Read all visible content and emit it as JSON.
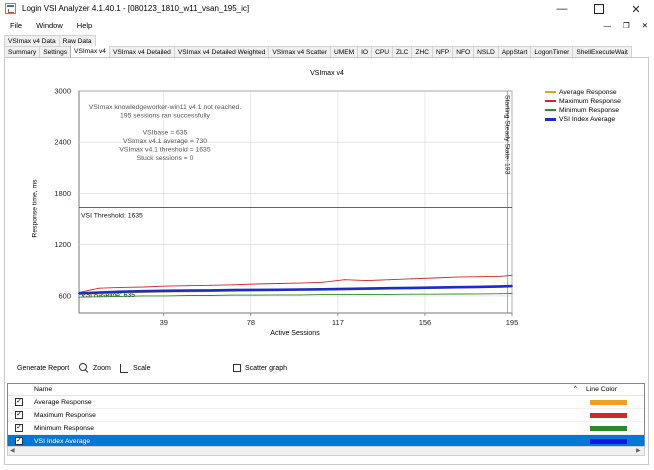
{
  "window": {
    "title": "Login VSI Analyzer 4.1.40.1 - [080123_1810_w11_vsan_195_ic]"
  },
  "menu": [
    "File",
    "Window",
    "Help"
  ],
  "tabs_row1": [
    "VSImax v4 Data",
    "Raw Data"
  ],
  "tabs_row2": [
    "Summary",
    "Settings",
    "VSImax v4",
    "VSImax v4 Detailed",
    "VSImax v4 Detailed Weighted",
    "VSImax v4 Scatter",
    "UMEM",
    "IO",
    "CPU",
    "ZLC",
    "ZHC",
    "NFP",
    "NFO",
    "NSLD",
    "AppStart",
    "LogonTimer",
    "ShellExecuteWait"
  ],
  "active_tab": "VSImax v4",
  "chart_data": {
    "type": "line",
    "title": "VSImax v4",
    "xlabel": "Active Sessions",
    "ylabel": "Response time, ms",
    "x_ticks": [
      "39",
      "78",
      "117",
      "156",
      "195"
    ],
    "y_ticks": [
      "600",
      "1200",
      "1800",
      "2400",
      "3000"
    ],
    "xlim": [
      1,
      195
    ],
    "ylim": [
      400,
      3000
    ],
    "info_lines": [
      "VSImax knowledgeworker-win11 v4.1 not reached.",
      "195 sessions ran successfully",
      "",
      "VSIbase = 635",
      "VSImax v4.1 average = 730",
      "VSImax v4.1 threshold = 1635",
      "Stuck sessions = 0"
    ],
    "threshold": {
      "value": 1635,
      "label": "VSI Threshold: 1635"
    },
    "baseline": {
      "value": 635,
      "label": "VSI Baseline: 635"
    },
    "steady_state": {
      "x": 193,
      "label": "Starting Steady State: 193"
    },
    "x": [
      1,
      10,
      20,
      30,
      40,
      50,
      60,
      70,
      80,
      90,
      100,
      110,
      120,
      130,
      140,
      150,
      160,
      170,
      180,
      190,
      195
    ],
    "series": [
      {
        "name": "Average Response",
        "color": "#e8a21a",
        "values": [
          620,
          625,
          635,
          640,
          645,
          648,
          652,
          655,
          660,
          662,
          665,
          668,
          672,
          675,
          680,
          684,
          688,
          692,
          697,
          702,
          705
        ]
      },
      {
        "name": "Maximum Response",
        "color": "#d0262b",
        "values": [
          640,
          690,
          700,
          705,
          715,
          720,
          725,
          730,
          740,
          745,
          750,
          760,
          790,
          780,
          790,
          800,
          810,
          820,
          825,
          830,
          840
        ]
      },
      {
        "name": "Minimum Response",
        "color": "#2e8b2e",
        "values": [
          585,
          590,
          595,
          600,
          600,
          605,
          605,
          610,
          610,
          612,
          612,
          615,
          615,
          618,
          618,
          620,
          620,
          622,
          624,
          626,
          628
        ]
      },
      {
        "name": "VSI Index Average",
        "color": "#1a2fbf",
        "values": [
          630,
          640,
          650,
          655,
          660,
          662,
          665,
          668,
          670,
          672,
          675,
          678,
          682,
          686,
          690,
          694,
          698,
          702,
          706,
          712,
          715
        ]
      }
    ],
    "legend_position": "top-right"
  },
  "controls": {
    "generate_report": "Generate Report",
    "zoom": "Zoom",
    "scale": "Scale",
    "scatter_graph": "Scatter graph"
  },
  "grid": {
    "header_name": "Name",
    "header_line_color": "Line Color",
    "rows": [
      {
        "name": "Average Response",
        "color": "#f0a020",
        "checked": true,
        "selected": false
      },
      {
        "name": "Maximum Response",
        "color": "#d4262b",
        "checked": true,
        "selected": false
      },
      {
        "name": "Minimum Response",
        "color": "#2a8a2a",
        "checked": true,
        "selected": false
      },
      {
        "name": "VSI Index Average",
        "color": "#1018e0",
        "checked": true,
        "selected": true
      }
    ]
  }
}
